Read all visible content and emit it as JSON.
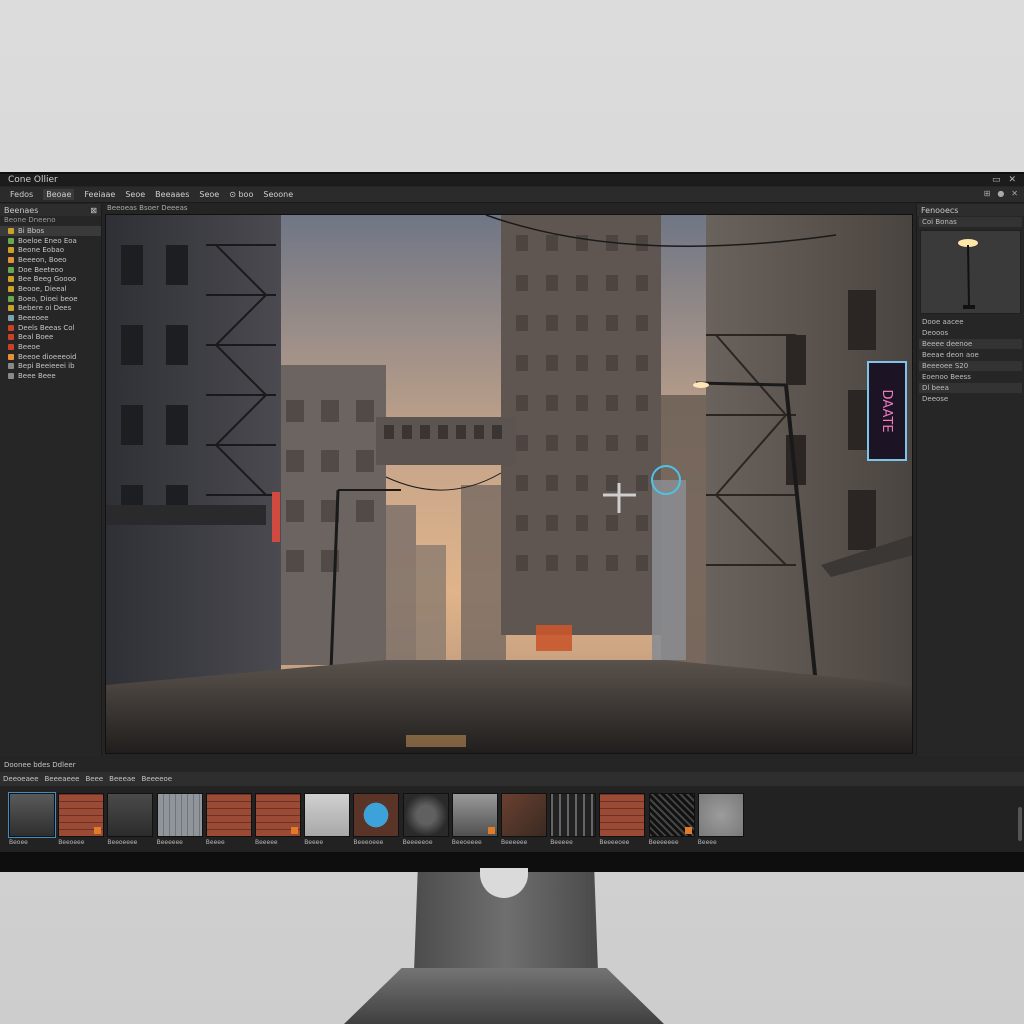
{
  "window": {
    "title": "Cone Ollier",
    "controls": [
      "▭",
      "✕"
    ]
  },
  "menu": {
    "items": [
      "Fedos",
      "Beoae",
      "Feeiaae",
      "Seoe",
      "Beeaaes",
      "Seoe",
      "⊙ boo",
      "Seoone"
    ],
    "right_icons": [
      "⊞",
      "●",
      "✕"
    ]
  },
  "left_panel": {
    "title": "Beenaes",
    "subtitle": "Beone Dneeno",
    "items": [
      {
        "label": "Bi Bbos",
        "color": "#c9a227"
      },
      {
        "label": "Boeloe Eneo Eoa",
        "color": "#6aa84f"
      },
      {
        "label": "Beone Eobao",
        "color": "#c9a227"
      },
      {
        "label": "Beeeon, Boeo",
        "color": "#e69138"
      },
      {
        "label": "Doe Beeteoo",
        "color": "#6aa84f"
      },
      {
        "label": "Bee Beeg Goooo",
        "color": "#c9a227"
      },
      {
        "label": "Beooe, Dieeal",
        "color": "#c9a227"
      },
      {
        "label": "Boeo, Dioei beoe",
        "color": "#6aa84f"
      },
      {
        "label": "Bebere oi Dees",
        "color": "#c9a227"
      },
      {
        "label": "Beeeoee",
        "color": "#76a5af"
      },
      {
        "label": "Deels Beeas Col",
        "color": "#cc4125"
      },
      {
        "label": "Beal Boee",
        "color": "#cc4125"
      },
      {
        "label": "Beeoe",
        "color": "#cc4125"
      },
      {
        "label": "Beeoe dioeeeoid",
        "color": "#e69138"
      },
      {
        "label": "Bepi Beeieeei ib",
        "color": "#888888"
      },
      {
        "label": "Beee Beee",
        "color": "#888888"
      }
    ]
  },
  "viewport": {
    "header": "Beeoeas Bsoer Deeeas",
    "sign_text": "DAATE"
  },
  "right_panel": {
    "title": "Fenooecs",
    "object_label": "Coi Bonas",
    "section": "Dooe aacee",
    "rows": [
      "Deooos",
      "Beeee deenoe",
      "Beeae deon aoe",
      "Beeeoee  S20",
      "Eoenoo Beess",
      "Dl beea",
      "Deeose"
    ]
  },
  "bottom_panel": {
    "title": "Doonee bdes  Ddleer",
    "tabs": [
      "Deeoeaee",
      "Beeeaeee",
      "Beee",
      "Beeeae",
      "Beeeeoe"
    ],
    "assets": [
      {
        "label": "Beoee",
        "kind": "gizmo"
      },
      {
        "label": "Beeoeee",
        "kind": "brick"
      },
      {
        "label": "Beeoeeee",
        "kind": "dark"
      },
      {
        "label": "Beeeeee",
        "kind": "stone"
      },
      {
        "label": "Beeee",
        "kind": "brick"
      },
      {
        "label": "Beeeee",
        "kind": "brick"
      },
      {
        "label": "Beeee",
        "kind": "light"
      },
      {
        "label": "Beeeoeee",
        "kind": "blue"
      },
      {
        "label": "Beeeeeoe",
        "kind": "rock"
      },
      {
        "label": "Beeoeeee",
        "kind": "metal"
      },
      {
        "label": "Beeeeee",
        "kind": "crate"
      },
      {
        "label": "Beeeee",
        "kind": "grid"
      },
      {
        "label": "Beeeeoee",
        "kind": "brick"
      },
      {
        "label": "Beeeeeee",
        "kind": "mesh"
      },
      {
        "label": "Beeee",
        "kind": "concrete"
      }
    ]
  }
}
